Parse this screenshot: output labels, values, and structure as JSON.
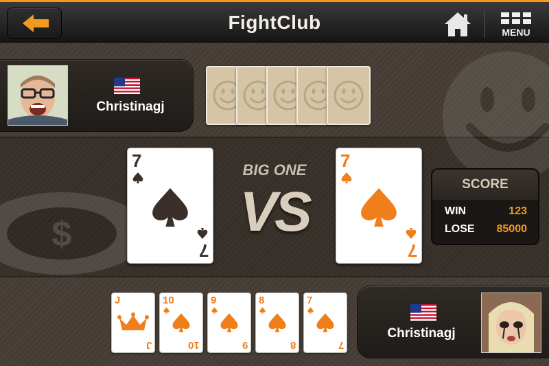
{
  "header": {
    "title": "FightClub",
    "menu_label": "MENU",
    "icons": {
      "back": "back-arrow-icon",
      "home": "home-icon",
      "menu": "menu-grid-icon"
    },
    "colors": {
      "accent": "#f39a1c"
    }
  },
  "opponent": {
    "name": "Christinagj",
    "flag": "us-flag-icon",
    "facedown_cards": 5
  },
  "battle": {
    "label": "BIG ONE",
    "vs": "VS",
    "opponent_card": {
      "rank": "7",
      "suit": "spade",
      "color": "#3a3029"
    },
    "player_card": {
      "rank": "7",
      "suit": "spade",
      "color": "#f07e1a"
    }
  },
  "score": {
    "title": "SCORE",
    "win_label": "WIN",
    "win_value": "123",
    "lose_label": "LOSE",
    "lose_value": "85000"
  },
  "player": {
    "name": "Christinagj",
    "flag": "us-flag-icon",
    "hand": [
      {
        "rank": "J",
        "suit": "crown"
      },
      {
        "rank": "10",
        "suit": "spade"
      },
      {
        "rank": "9",
        "suit": "spade"
      },
      {
        "rank": "8",
        "suit": "spade"
      },
      {
        "rank": "7",
        "suit": "spade"
      }
    ]
  }
}
